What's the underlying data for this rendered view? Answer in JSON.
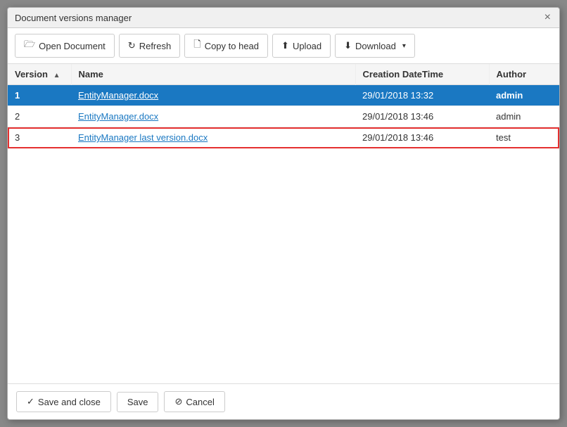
{
  "dialog": {
    "title": "Document versions manager",
    "close_label": "×"
  },
  "toolbar": {
    "open_document": "Open Document",
    "refresh": "Refresh",
    "copy_to_head": "Copy to head",
    "upload": "Upload",
    "download": "Download"
  },
  "table": {
    "columns": [
      {
        "key": "version",
        "label": "Version",
        "sortable": true
      },
      {
        "key": "name",
        "label": "Name"
      },
      {
        "key": "datetime",
        "label": "Creation DateTime"
      },
      {
        "key": "author",
        "label": "Author"
      }
    ],
    "rows": [
      {
        "version": "1",
        "name": "EntityManager.docx",
        "datetime": "29/01/2018 13:32",
        "author": "admin",
        "selected": true,
        "highlighted": false
      },
      {
        "version": "2",
        "name": "EntityManager.docx",
        "datetime": "29/01/2018 13:46",
        "author": "admin",
        "selected": false,
        "highlighted": false
      },
      {
        "version": "3",
        "name": "EntityManager last version.docx",
        "datetime": "29/01/2018 13:46",
        "author": "test",
        "selected": false,
        "highlighted": true
      }
    ]
  },
  "footer": {
    "save_and_close": "Save and close",
    "save": "Save",
    "cancel": "Cancel"
  },
  "icons": {
    "open_document": "🗁",
    "refresh": "↻",
    "copy_to_head": "🗋",
    "upload": "⬆",
    "download": "⬇",
    "check": "✓",
    "cancel": "⊘",
    "sort_asc": "▲"
  }
}
